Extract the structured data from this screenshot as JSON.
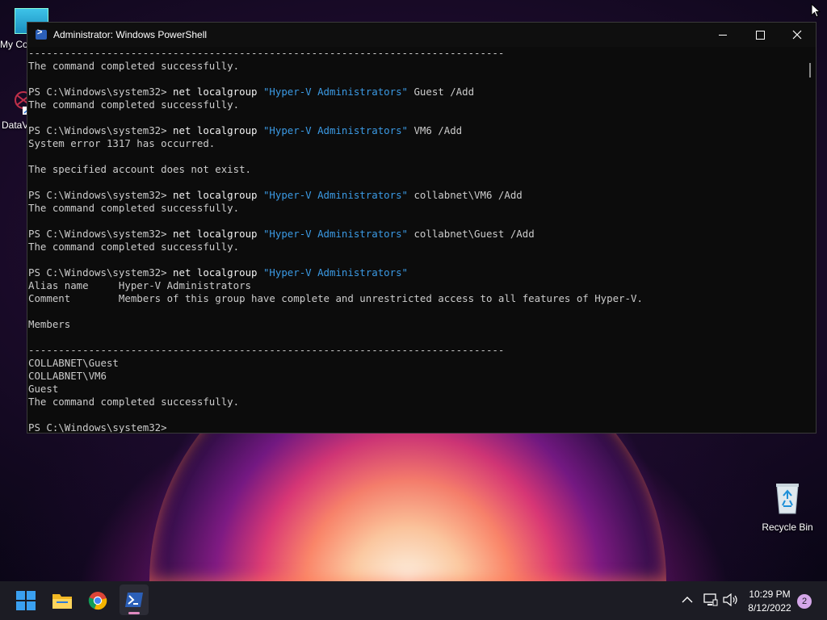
{
  "window": {
    "title": "Administrator: Windows PowerShell"
  },
  "console_lines": [
    {
      "parts": [
        {
          "t": "-------------------------------------------------------------------------------",
          "c": "out"
        }
      ]
    },
    {
      "parts": [
        {
          "t": "The command completed successfully.",
          "c": "out"
        }
      ]
    },
    {
      "parts": [
        {
          "t": "",
          "c": "out"
        }
      ]
    },
    {
      "parts": [
        {
          "t": "PS C:\\Windows\\system32> ",
          "c": "out"
        },
        {
          "t": "net localgroup ",
          "c": "kw"
        },
        {
          "t": "\"Hyper-V Administrators\"",
          "c": "str"
        },
        {
          "t": " Guest /Add",
          "c": "out"
        }
      ]
    },
    {
      "parts": [
        {
          "t": "The command completed successfully.",
          "c": "out"
        }
      ]
    },
    {
      "parts": [
        {
          "t": "",
          "c": "out"
        }
      ]
    },
    {
      "parts": [
        {
          "t": "PS C:\\Windows\\system32> ",
          "c": "out"
        },
        {
          "t": "net localgroup ",
          "c": "kw"
        },
        {
          "t": "\"Hyper-V Administrators\"",
          "c": "str"
        },
        {
          "t": " VM6 /Add",
          "c": "out"
        }
      ]
    },
    {
      "parts": [
        {
          "t": "System error 1317 has occurred.",
          "c": "out"
        }
      ]
    },
    {
      "parts": [
        {
          "t": "",
          "c": "out"
        }
      ]
    },
    {
      "parts": [
        {
          "t": "The specified account does not exist.",
          "c": "out"
        }
      ]
    },
    {
      "parts": [
        {
          "t": "",
          "c": "out"
        }
      ]
    },
    {
      "parts": [
        {
          "t": "PS C:\\Windows\\system32> ",
          "c": "out"
        },
        {
          "t": "net localgroup ",
          "c": "kw"
        },
        {
          "t": "\"Hyper-V Administrators\"",
          "c": "str"
        },
        {
          "t": " collabnet\\VM6 /Add",
          "c": "out"
        }
      ]
    },
    {
      "parts": [
        {
          "t": "The command completed successfully.",
          "c": "out"
        }
      ]
    },
    {
      "parts": [
        {
          "t": "",
          "c": "out"
        }
      ]
    },
    {
      "parts": [
        {
          "t": "PS C:\\Windows\\system32> ",
          "c": "out"
        },
        {
          "t": "net localgroup ",
          "c": "kw"
        },
        {
          "t": "\"Hyper-V Administrators\"",
          "c": "str"
        },
        {
          "t": " collabnet\\Guest /Add",
          "c": "out"
        }
      ]
    },
    {
      "parts": [
        {
          "t": "The command completed successfully.",
          "c": "out"
        }
      ]
    },
    {
      "parts": [
        {
          "t": "",
          "c": "out"
        }
      ]
    },
    {
      "parts": [
        {
          "t": "PS C:\\Windows\\system32> ",
          "c": "out"
        },
        {
          "t": "net localgroup ",
          "c": "kw"
        },
        {
          "t": "\"Hyper-V Administrators\"",
          "c": "str"
        }
      ]
    },
    {
      "parts": [
        {
          "t": "Alias name     Hyper-V Administrators",
          "c": "out"
        }
      ]
    },
    {
      "parts": [
        {
          "t": "Comment        Members of this group have complete and unrestricted access to all features of Hyper-V.",
          "c": "out"
        }
      ]
    },
    {
      "parts": [
        {
          "t": "",
          "c": "out"
        }
      ]
    },
    {
      "parts": [
        {
          "t": "Members",
          "c": "out"
        }
      ]
    },
    {
      "parts": [
        {
          "t": "",
          "c": "out"
        }
      ]
    },
    {
      "parts": [
        {
          "t": "-------------------------------------------------------------------------------",
          "c": "out"
        }
      ]
    },
    {
      "parts": [
        {
          "t": "COLLABNET\\Guest",
          "c": "out"
        }
      ]
    },
    {
      "parts": [
        {
          "t": "COLLABNET\\VM6",
          "c": "out"
        }
      ]
    },
    {
      "parts": [
        {
          "t": "Guest",
          "c": "out"
        }
      ]
    },
    {
      "parts": [
        {
          "t": "The command completed successfully.",
          "c": "out"
        }
      ]
    },
    {
      "parts": [
        {
          "t": "",
          "c": "out"
        }
      ]
    },
    {
      "parts": [
        {
          "t": "PS C:\\Windows\\system32>",
          "c": "out"
        }
      ]
    }
  ],
  "desktop": {
    "icons": [
      {
        "label": "My Co",
        "icon": "computer-icon"
      },
      {
        "label": "DataV",
        "icon": "shortcut-icon"
      },
      {
        "label": "Recycle Bin",
        "icon": "recycle-bin-icon"
      }
    ]
  },
  "taskbar": {
    "apps": [
      "start-icon",
      "file-explorer-icon",
      "chrome-icon",
      "powershell-icon"
    ],
    "clock_time": "10:29 PM",
    "clock_date": "8/12/2022",
    "notification_count": "2"
  },
  "colors": {
    "console_bg": "#0c0c0c",
    "console_text": "#cccccc",
    "string_color": "#3b9ae4",
    "taskbar_bg": "#1c1c24"
  }
}
